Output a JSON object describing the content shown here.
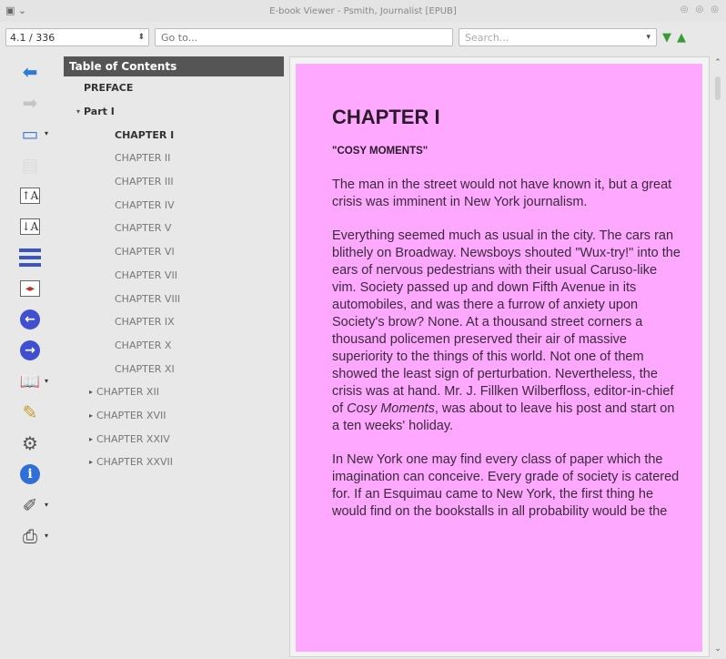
{
  "window": {
    "title": "E-book Viewer - Psmith, Journalist [EPUB]"
  },
  "toolbar": {
    "page_position": "4.1 / 336",
    "goto_placeholder": "Go to...",
    "search_placeholder": "Search..."
  },
  "toc": {
    "header": "Table of Contents",
    "items": [
      {
        "label": "PREFACE",
        "level": 0,
        "bold": true,
        "bullet": ""
      },
      {
        "label": "Part I",
        "level": 0,
        "bold": true,
        "bullet": "▾"
      },
      {
        "label": "CHAPTER I",
        "level": 2,
        "bold": true,
        "bullet": ""
      },
      {
        "label": "CHAPTER II",
        "level": 2,
        "bold": false,
        "bullet": ""
      },
      {
        "label": "CHAPTER III",
        "level": 2,
        "bold": false,
        "bullet": ""
      },
      {
        "label": "CHAPTER IV",
        "level": 2,
        "bold": false,
        "bullet": ""
      },
      {
        "label": "CHAPTER V",
        "level": 2,
        "bold": false,
        "bullet": ""
      },
      {
        "label": "CHAPTER VI",
        "level": 2,
        "bold": false,
        "bullet": ""
      },
      {
        "label": "CHAPTER VII",
        "level": 2,
        "bold": false,
        "bullet": ""
      },
      {
        "label": "CHAPTER VIII",
        "level": 2,
        "bold": false,
        "bullet": ""
      },
      {
        "label": "CHAPTER IX",
        "level": 2,
        "bold": false,
        "bullet": ""
      },
      {
        "label": "CHAPTER X",
        "level": 2,
        "bold": false,
        "bullet": ""
      },
      {
        "label": "CHAPTER XI",
        "level": 2,
        "bold": false,
        "bullet": ""
      },
      {
        "label": "CHAPTER XII",
        "level": 1,
        "bold": false,
        "bullet": "▸"
      },
      {
        "label": "CHAPTER XVII",
        "level": 1,
        "bold": false,
        "bullet": "▸"
      },
      {
        "label": "CHAPTER XXIV",
        "level": 1,
        "bold": false,
        "bullet": "▸"
      },
      {
        "label": "CHAPTER XXVII",
        "level": 1,
        "bold": false,
        "bullet": "▸"
      }
    ]
  },
  "content": {
    "chapter_title": "CHAPTER I",
    "subtitle": "\"COSY MOMENTS\"",
    "paragraph1": "The man in the street would not have known it, but a great crisis was imminent in New York journalism.",
    "paragraph2": "Everything seemed much as usual in the city. The cars ran blithely on Broadway. Newsboys shouted \"Wux-try!\" into the ears of nervous pedestrians with their usual Caruso-like vim. Society passed up and down Fifth Avenue in its automobiles, and was there a furrow of anxiety upon Society's brow? None. At a thousand street corners a thousand policemen preserved their air of massive superiority to the things of this world. Not one of them showed the least sign of perturbation. Nevertheless, the crisis was at hand. Mr. J. Fillken Wilberfloss, editor-in-chief of ",
    "paragraph2_italic": "Cosy Moments",
    "paragraph2_end": ", was about to leave his post and start on a ten weeks' holiday.",
    "paragraph3": "In New York one may find every class of paper which the imagination can conceive. Every grade of society is catered for. If an Esquimau came to New York, the first thing he would find on the bookstalls in all probability would be the"
  },
  "colors": {
    "page_background": "#ffa8ff",
    "toc_header": "#555555",
    "accent_blue": "#2e7bd6",
    "nav_green": "#3a9a3a"
  },
  "icons": [
    "back-arrow-icon",
    "forward-arrow-icon",
    "library-icon",
    "copy-icon",
    "font-larger-icon",
    "font-smaller-icon",
    "toc-icon",
    "fullscreen-icon",
    "previous-page-icon",
    "next-page-icon",
    "reference-mode-icon",
    "bookmark-icon",
    "preferences-icon",
    "info-icon",
    "tweak-icon",
    "print-icon"
  ]
}
